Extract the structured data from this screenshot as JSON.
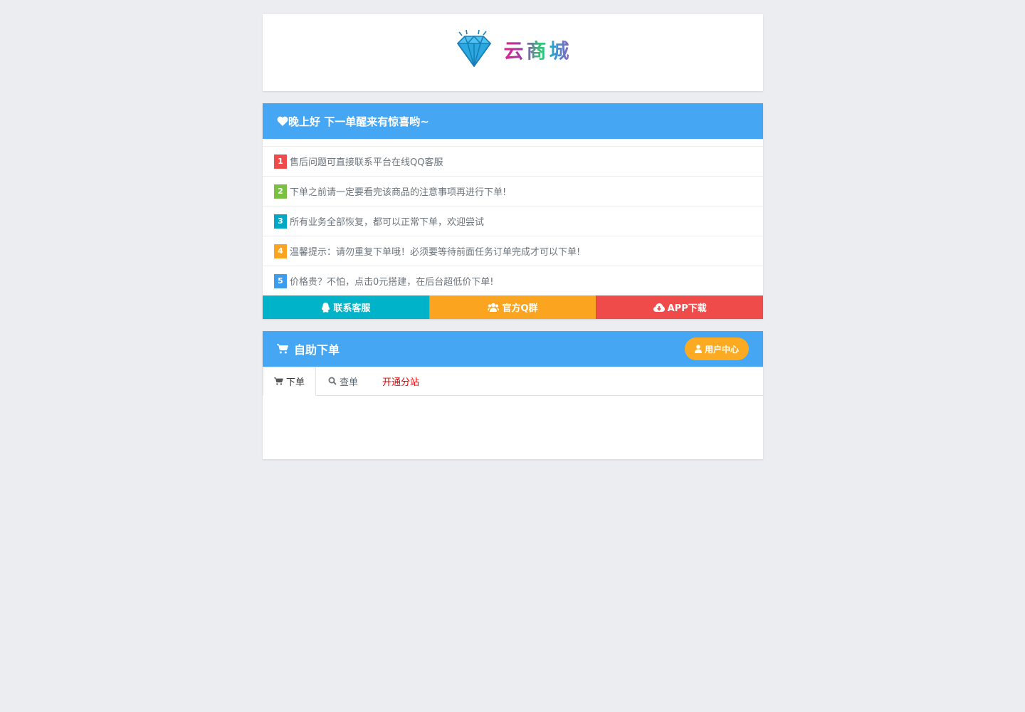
{
  "logo": {
    "text": "云商城",
    "icon": "diamond-icon"
  },
  "notice": {
    "header": "晚上好 下一单醒来有惊喜哟~",
    "header_icon": "heart-icon",
    "items": [
      {
        "num": "1",
        "text": "售后问题可直接联系平台在线QQ客服",
        "color": "#f04b4b"
      },
      {
        "num": "2",
        "text": "下单之前请一定要看完该商品的注意事项再进行下单!",
        "color": "#7ac143"
      },
      {
        "num": "3",
        "text": "所有业务全部恢复，都可以正常下单，欢迎尝试",
        "color": "#00a8c6"
      },
      {
        "num": "4",
        "text": "温馨提示：请勿重复下单哦！必须要等待前面任务订单完成才可以下单!",
        "color": "#fba41f"
      },
      {
        "num": "5",
        "text": "价格贵？不怕，点击0元搭建，在后台超低价下单!",
        "color": "#3c9df0"
      }
    ],
    "buttons": [
      {
        "label": "联系客服",
        "icon": "qq-icon",
        "color": "#00b3c8"
      },
      {
        "label": "官方Q群",
        "icon": "group-icon",
        "color": "#fba41f"
      },
      {
        "label": "APP下载",
        "icon": "cloud-download-icon",
        "color": "#f04b4b"
      }
    ]
  },
  "order": {
    "title": "自助下单",
    "title_icon": "cart-icon",
    "user_center": "用户中心",
    "user_icon": "user-icon",
    "tabs": [
      {
        "label": "下单",
        "icon": "cart-icon"
      },
      {
        "label": "查单",
        "icon": "search-icon"
      },
      {
        "label": "开通分站",
        "icon": ""
      }
    ]
  },
  "colors": {
    "header_blue": "#45a6f4",
    "background": "#ebedf1",
    "accent_orange": "#fbaa21",
    "link_red": "#ee0000"
  }
}
